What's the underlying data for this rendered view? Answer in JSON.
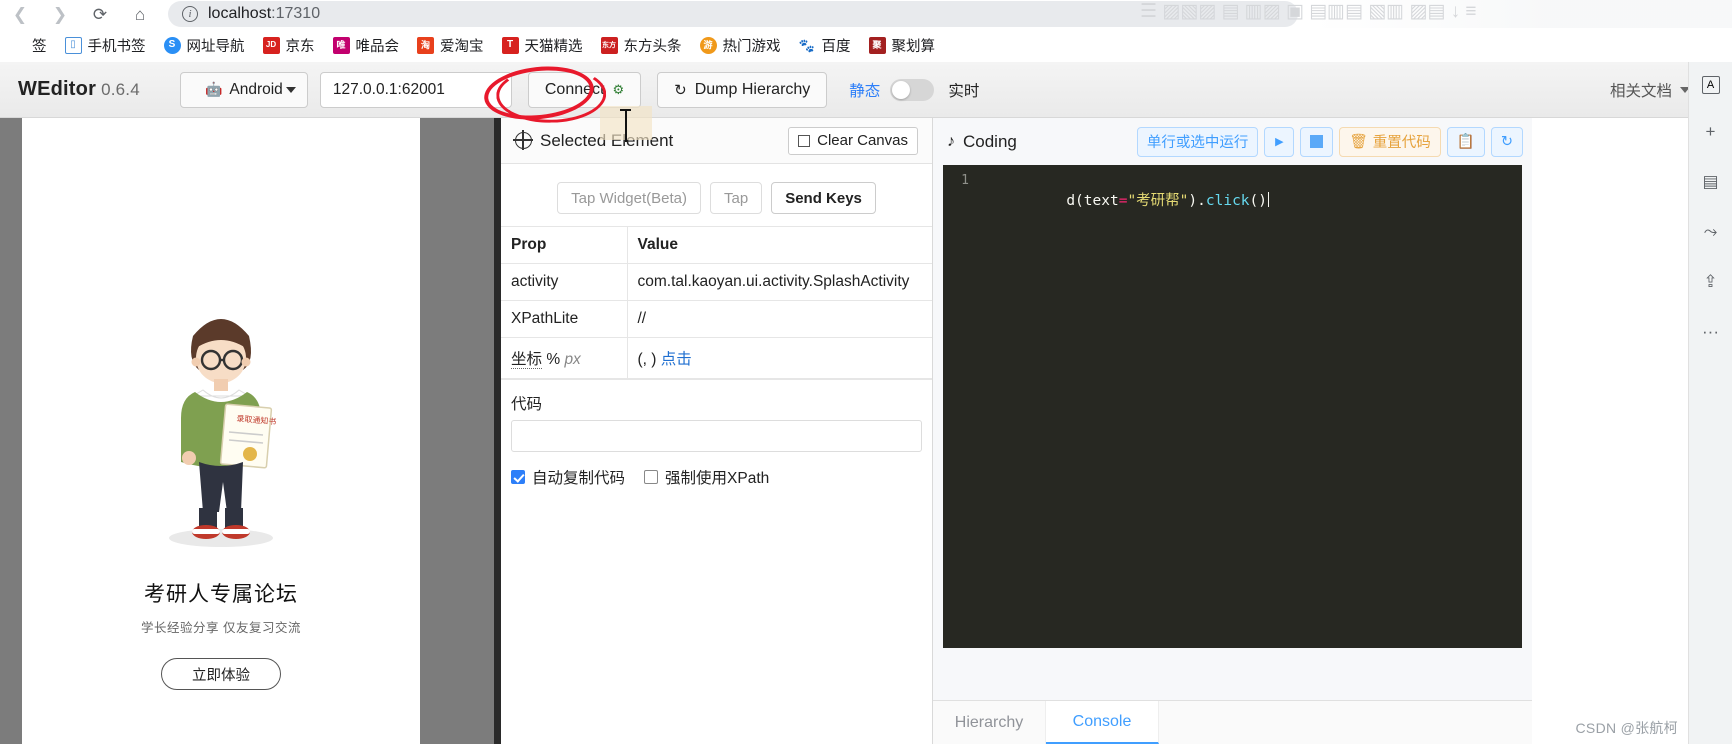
{
  "browser": {
    "nav": {
      "back_icon": "chevron-left-icon",
      "forward_icon": "chevron-right-icon",
      "reload_icon": "reload-icon",
      "home_icon": "home-icon"
    },
    "omnibox": {
      "info_icon": "info-circle-icon",
      "host": "localhost",
      "port": ":17310",
      "full_url": "localhost:17310"
    },
    "bookmarks": [
      {
        "label": "签",
        "icon": "folder-icon",
        "color": "#ffffff"
      },
      {
        "label": "手机书签",
        "icon": "mobile-bookmark-icon",
        "color": "#4a90d9"
      },
      {
        "label": "网址导航",
        "icon": "compass-icon",
        "color": "#2a8ff5"
      },
      {
        "label": "京东",
        "icon": "jd-icon",
        "color": "#d7221f"
      },
      {
        "label": "唯品会",
        "icon": "vip-icon",
        "color": "#c2006e"
      },
      {
        "label": "爱淘宝",
        "icon": "taobao-icon",
        "color": "#e8401c"
      },
      {
        "label": "天猫精选",
        "icon": "tmall-icon",
        "color": "#d7221f"
      },
      {
        "label": "东方头条",
        "icon": "dongfang-icon",
        "color": "#cc2020"
      },
      {
        "label": "热门游戏",
        "icon": "game-icon",
        "color": "#f0991a"
      },
      {
        "label": "百度",
        "icon": "baidu-paw-icon",
        "color": "#2932e1"
      },
      {
        "label": "聚划算",
        "icon": "juhuasuan-icon",
        "color": "#a32020"
      }
    ],
    "right_rail": [
      {
        "icon": "translate-panel-icon",
        "glyph": "A"
      },
      {
        "icon": "add-icon",
        "glyph": "+"
      },
      {
        "icon": "reading-list-icon",
        "glyph": "▤"
      },
      {
        "icon": "share-icon",
        "glyph": "⤳"
      },
      {
        "icon": "export-icon",
        "glyph": "⇪"
      },
      {
        "icon": "more-icon",
        "glyph": "···"
      }
    ],
    "watermark": "CSDN @张航柯"
  },
  "toolbar": {
    "brand": "WEditor",
    "version": "0.6.4",
    "platform_select": {
      "value": "Android",
      "icon": "android-icon"
    },
    "serial_input": {
      "value": "127.0.0.1:62001",
      "placeholder": ""
    },
    "connect_button": "Connect",
    "connect_icon": "plug-icon",
    "dump_button": "Dump Hierarchy",
    "dump_icon": "refresh-icon",
    "static_label": "静态",
    "live_label": "实时",
    "toggle_state": "off",
    "docs_link": "相关文档"
  },
  "device": {
    "splash_title": "考研人专属论坛",
    "splash_sub": "学长经验分享 仅友复习交流",
    "splash_button": "立即体验",
    "illustration": "student-with-certificate-illustration"
  },
  "inspector": {
    "panel_title": "Selected Element",
    "panel_icon": "target-icon",
    "clear_canvas": "Clear Canvas",
    "actions": [
      {
        "label": "Tap Widget(Beta)",
        "emphasis": "muted"
      },
      {
        "label": "Tap",
        "emphasis": "muted"
      },
      {
        "label": "Send Keys",
        "emphasis": "strong"
      }
    ],
    "table": {
      "headers": [
        "Prop",
        "Value"
      ],
      "rows": [
        {
          "prop": "activity",
          "value": "com.tal.kaoyan.ui.activity.SplashActivity"
        },
        {
          "prop": "XPathLite",
          "value": "//"
        },
        {
          "prop": "坐标",
          "prop_unit_pct": "%",
          "prop_unit_px": "px",
          "value": "(, )",
          "value_link": "点击"
        }
      ]
    },
    "code_label": "代码",
    "code_value": "",
    "checkboxes": [
      {
        "label": "自动复制代码",
        "checked": true
      },
      {
        "label": "强制使用XPath",
        "checked": false
      }
    ]
  },
  "coding": {
    "panel_title": "Coding",
    "panel_icon": "music-note-icon",
    "buttons": [
      {
        "label": "单行或选中运行",
        "name": "run-selection-button"
      },
      {
        "label": "▶",
        "name": "run-button"
      },
      {
        "label": "",
        "name": "stop-button"
      },
      {
        "label": "重置代码",
        "name": "reset-code-button",
        "icon": "trash-icon"
      },
      {
        "label": "",
        "name": "copy-button",
        "icon": "copy-icon"
      },
      {
        "label": "",
        "name": "refresh-button",
        "icon": "refresh-icon"
      }
    ],
    "editor": {
      "line_number": "1",
      "code": "d(text=\"考研帮\").click()",
      "tokens": [
        {
          "t": "d(",
          "cls": "plain"
        },
        {
          "t": "text",
          "cls": "plain"
        },
        {
          "t": "=",
          "cls": "op"
        },
        {
          "t": "\"考研帮\"",
          "cls": "str"
        },
        {
          "t": ")",
          "cls": "plain"
        },
        {
          "t": ".",
          "cls": "plain"
        },
        {
          "t": "click",
          "cls": "meth"
        },
        {
          "t": "()",
          "cls": "plain"
        }
      ]
    },
    "tabs": [
      {
        "label": "Hierarchy",
        "active": false
      },
      {
        "label": "Console",
        "active": true
      }
    ]
  }
}
